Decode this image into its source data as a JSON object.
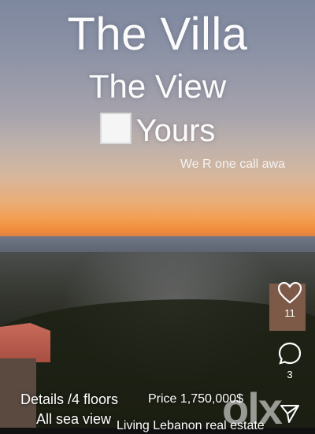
{
  "post": {
    "headline_1": "The Villa",
    "headline_2": "The View",
    "headline_3": "Yours",
    "tagline": "We R one call awa",
    "details": "Details /4 floors",
    "sea_view": "All sea view",
    "price": "Price 1,750,000$",
    "real_estate": "Living Lebanon real estate"
  },
  "actions": {
    "likes_count": "11",
    "comments_count": "3",
    "like_icon": "heart-icon",
    "comment_icon": "comment-bubble-icon",
    "share_icon": "send-icon"
  },
  "watermark": {
    "text": "olx"
  }
}
